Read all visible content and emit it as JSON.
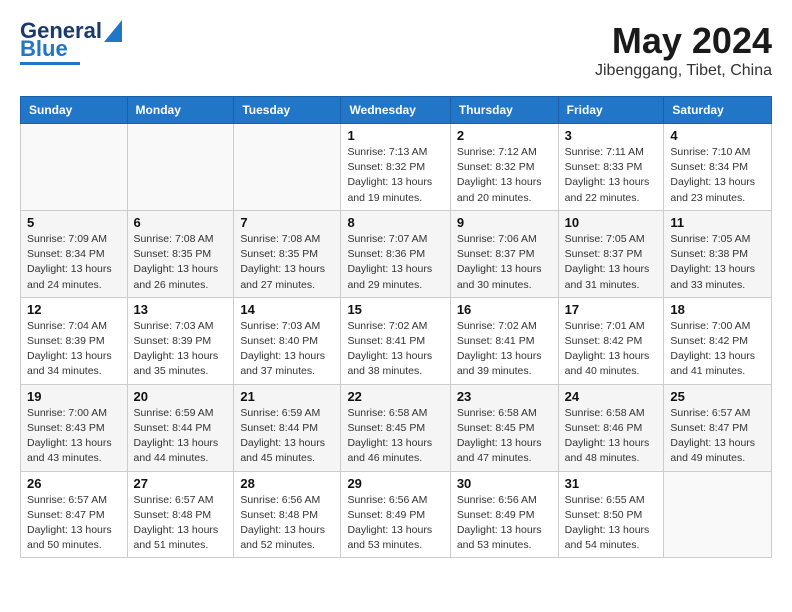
{
  "header": {
    "logo_line1": "General",
    "logo_line2": "Blue",
    "month": "May 2024",
    "location": "Jibenggang, Tibet, China"
  },
  "days_of_week": [
    "Sunday",
    "Monday",
    "Tuesday",
    "Wednesday",
    "Thursday",
    "Friday",
    "Saturday"
  ],
  "weeks": [
    [
      {
        "day": "",
        "info": ""
      },
      {
        "day": "",
        "info": ""
      },
      {
        "day": "",
        "info": ""
      },
      {
        "day": "1",
        "info": "Sunrise: 7:13 AM\nSunset: 8:32 PM\nDaylight: 13 hours and 19 minutes."
      },
      {
        "day": "2",
        "info": "Sunrise: 7:12 AM\nSunset: 8:32 PM\nDaylight: 13 hours and 20 minutes."
      },
      {
        "day": "3",
        "info": "Sunrise: 7:11 AM\nSunset: 8:33 PM\nDaylight: 13 hours and 22 minutes."
      },
      {
        "day": "4",
        "info": "Sunrise: 7:10 AM\nSunset: 8:34 PM\nDaylight: 13 hours and 23 minutes."
      }
    ],
    [
      {
        "day": "5",
        "info": "Sunrise: 7:09 AM\nSunset: 8:34 PM\nDaylight: 13 hours and 24 minutes."
      },
      {
        "day": "6",
        "info": "Sunrise: 7:08 AM\nSunset: 8:35 PM\nDaylight: 13 hours and 26 minutes."
      },
      {
        "day": "7",
        "info": "Sunrise: 7:08 AM\nSunset: 8:35 PM\nDaylight: 13 hours and 27 minutes."
      },
      {
        "day": "8",
        "info": "Sunrise: 7:07 AM\nSunset: 8:36 PM\nDaylight: 13 hours and 29 minutes."
      },
      {
        "day": "9",
        "info": "Sunrise: 7:06 AM\nSunset: 8:37 PM\nDaylight: 13 hours and 30 minutes."
      },
      {
        "day": "10",
        "info": "Sunrise: 7:05 AM\nSunset: 8:37 PM\nDaylight: 13 hours and 31 minutes."
      },
      {
        "day": "11",
        "info": "Sunrise: 7:05 AM\nSunset: 8:38 PM\nDaylight: 13 hours and 33 minutes."
      }
    ],
    [
      {
        "day": "12",
        "info": "Sunrise: 7:04 AM\nSunset: 8:39 PM\nDaylight: 13 hours and 34 minutes."
      },
      {
        "day": "13",
        "info": "Sunrise: 7:03 AM\nSunset: 8:39 PM\nDaylight: 13 hours and 35 minutes."
      },
      {
        "day": "14",
        "info": "Sunrise: 7:03 AM\nSunset: 8:40 PM\nDaylight: 13 hours and 37 minutes."
      },
      {
        "day": "15",
        "info": "Sunrise: 7:02 AM\nSunset: 8:41 PM\nDaylight: 13 hours and 38 minutes."
      },
      {
        "day": "16",
        "info": "Sunrise: 7:02 AM\nSunset: 8:41 PM\nDaylight: 13 hours and 39 minutes."
      },
      {
        "day": "17",
        "info": "Sunrise: 7:01 AM\nSunset: 8:42 PM\nDaylight: 13 hours and 40 minutes."
      },
      {
        "day": "18",
        "info": "Sunrise: 7:00 AM\nSunset: 8:42 PM\nDaylight: 13 hours and 41 minutes."
      }
    ],
    [
      {
        "day": "19",
        "info": "Sunrise: 7:00 AM\nSunset: 8:43 PM\nDaylight: 13 hours and 43 minutes."
      },
      {
        "day": "20",
        "info": "Sunrise: 6:59 AM\nSunset: 8:44 PM\nDaylight: 13 hours and 44 minutes."
      },
      {
        "day": "21",
        "info": "Sunrise: 6:59 AM\nSunset: 8:44 PM\nDaylight: 13 hours and 45 minutes."
      },
      {
        "day": "22",
        "info": "Sunrise: 6:58 AM\nSunset: 8:45 PM\nDaylight: 13 hours and 46 minutes."
      },
      {
        "day": "23",
        "info": "Sunrise: 6:58 AM\nSunset: 8:45 PM\nDaylight: 13 hours and 47 minutes."
      },
      {
        "day": "24",
        "info": "Sunrise: 6:58 AM\nSunset: 8:46 PM\nDaylight: 13 hours and 48 minutes."
      },
      {
        "day": "25",
        "info": "Sunrise: 6:57 AM\nSunset: 8:47 PM\nDaylight: 13 hours and 49 minutes."
      }
    ],
    [
      {
        "day": "26",
        "info": "Sunrise: 6:57 AM\nSunset: 8:47 PM\nDaylight: 13 hours and 50 minutes."
      },
      {
        "day": "27",
        "info": "Sunrise: 6:57 AM\nSunset: 8:48 PM\nDaylight: 13 hours and 51 minutes."
      },
      {
        "day": "28",
        "info": "Sunrise: 6:56 AM\nSunset: 8:48 PM\nDaylight: 13 hours and 52 minutes."
      },
      {
        "day": "29",
        "info": "Sunrise: 6:56 AM\nSunset: 8:49 PM\nDaylight: 13 hours and 53 minutes."
      },
      {
        "day": "30",
        "info": "Sunrise: 6:56 AM\nSunset: 8:49 PM\nDaylight: 13 hours and 53 minutes."
      },
      {
        "day": "31",
        "info": "Sunrise: 6:55 AM\nSunset: 8:50 PM\nDaylight: 13 hours and 54 minutes."
      },
      {
        "day": "",
        "info": ""
      }
    ]
  ]
}
